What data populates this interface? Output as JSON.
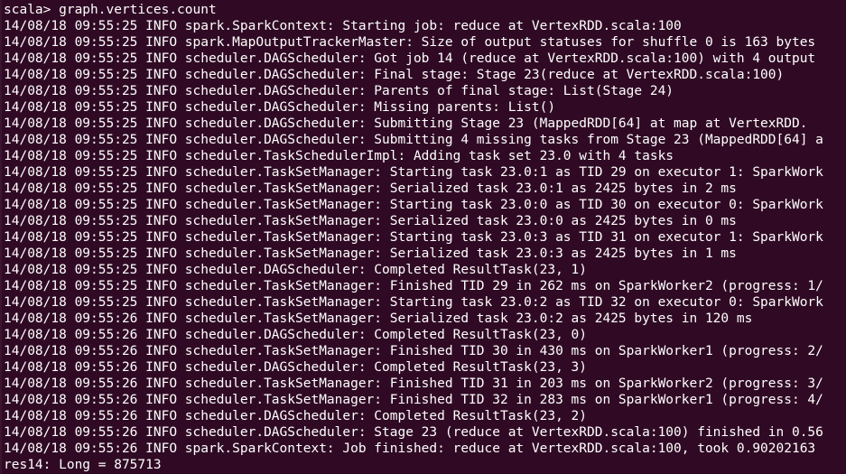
{
  "terminal": {
    "background": "#300a24",
    "foreground": "#ffffff",
    "lines": [
      "scala> graph.vertices.count",
      "14/08/18 09:55:25 INFO spark.SparkContext: Starting job: reduce at VertexRDD.scala:100",
      "14/08/18 09:55:25 INFO spark.MapOutputTrackerMaster: Size of output statuses for shuffle 0 is 163 bytes",
      "14/08/18 09:55:25 INFO scheduler.DAGScheduler: Got job 14 (reduce at VertexRDD.scala:100) with 4 output",
      "14/08/18 09:55:25 INFO scheduler.DAGScheduler: Final stage: Stage 23(reduce at VertexRDD.scala:100)",
      "14/08/18 09:55:25 INFO scheduler.DAGScheduler: Parents of final stage: List(Stage 24)",
      "14/08/18 09:55:25 INFO scheduler.DAGScheduler: Missing parents: List()",
      "14/08/18 09:55:25 INFO scheduler.DAGScheduler: Submitting Stage 23 (MappedRDD[64] at map at VertexRDD.",
      "14/08/18 09:55:25 INFO scheduler.DAGScheduler: Submitting 4 missing tasks from Stage 23 (MappedRDD[64] a",
      "14/08/18 09:55:25 INFO scheduler.TaskSchedulerImpl: Adding task set 23.0 with 4 tasks",
      "14/08/18 09:55:25 INFO scheduler.TaskSetManager: Starting task 23.0:1 as TID 29 on executor 1: SparkWork",
      "14/08/18 09:55:25 INFO scheduler.TaskSetManager: Serialized task 23.0:1 as 2425 bytes in 2 ms",
      "14/08/18 09:55:25 INFO scheduler.TaskSetManager: Starting task 23.0:0 as TID 30 on executor 0: SparkWork",
      "14/08/18 09:55:25 INFO scheduler.TaskSetManager: Serialized task 23.0:0 as 2425 bytes in 0 ms",
      "14/08/18 09:55:25 INFO scheduler.TaskSetManager: Starting task 23.0:3 as TID 31 on executor 1: SparkWork",
      "14/08/18 09:55:25 INFO scheduler.TaskSetManager: Serialized task 23.0:3 as 2425 bytes in 1 ms",
      "14/08/18 09:55:25 INFO scheduler.DAGScheduler: Completed ResultTask(23, 1)",
      "14/08/18 09:55:25 INFO scheduler.TaskSetManager: Finished TID 29 in 262 ms on SparkWorker2 (progress: 1/",
      "14/08/18 09:55:25 INFO scheduler.TaskSetManager: Starting task 23.0:2 as TID 32 on executor 0: SparkWork",
      "14/08/18 09:55:26 INFO scheduler.TaskSetManager: Serialized task 23.0:2 as 2425 bytes in 120 ms",
      "14/08/18 09:55:26 INFO scheduler.DAGScheduler: Completed ResultTask(23, 0)",
      "14/08/18 09:55:26 INFO scheduler.TaskSetManager: Finished TID 30 in 430 ms on SparkWorker1 (progress: 2/",
      "14/08/18 09:55:26 INFO scheduler.DAGScheduler: Completed ResultTask(23, 3)",
      "14/08/18 09:55:26 INFO scheduler.TaskSetManager: Finished TID 31 in 203 ms on SparkWorker2 (progress: 3/",
      "14/08/18 09:55:26 INFO scheduler.TaskSetManager: Finished TID 32 in 283 ms on SparkWorker1 (progress: 4/",
      "14/08/18 09:55:26 INFO scheduler.DAGScheduler: Completed ResultTask(23, 2)",
      "14/08/18 09:55:26 INFO scheduler.DAGScheduler: Stage 23 (reduce at VertexRDD.scala:100) finished in 0.56",
      "14/08/18 09:55:26 INFO spark.SparkContext: Job finished: reduce at VertexRDD.scala:100, took 0.90202163",
      "res14: Long = 875713"
    ]
  }
}
